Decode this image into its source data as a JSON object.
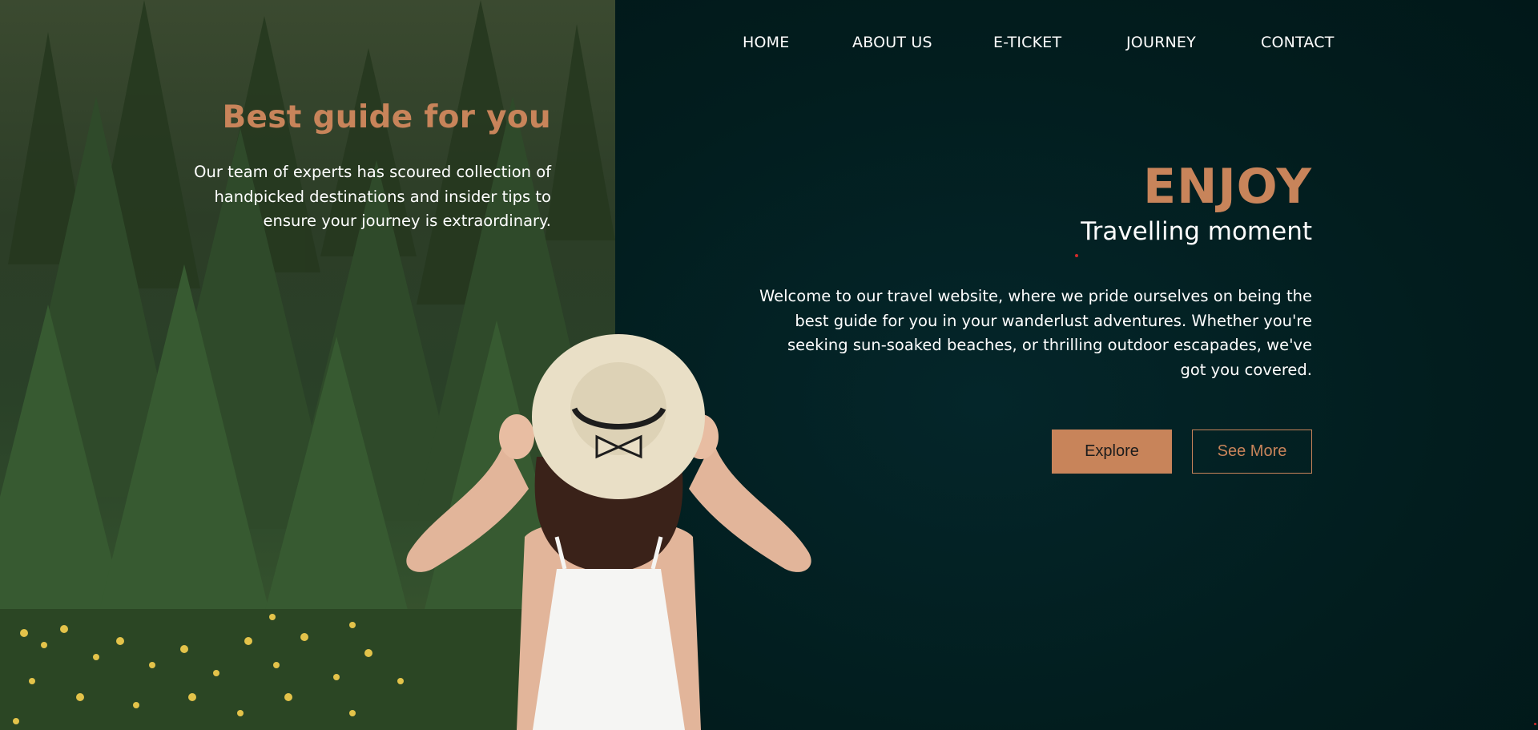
{
  "nav": {
    "items": [
      "HOME",
      "ABOUT US",
      "E-TICKET",
      "JOURNEY",
      "CONTACT"
    ]
  },
  "guide": {
    "title": "Best guide for you",
    "text": "Our team of experts has scoured collection of handpicked destinations and insider tips to ensure your journey is extraordinary."
  },
  "hero": {
    "headline": "ENJOY",
    "subtitle": "Travelling moment",
    "intro": "Welcome to our travel website, where we pride ourselves on being the best guide for you in your wanderlust adventures. Whether you're seeking sun-soaked beaches, or thrilling outdoor escapades, we've got you covered."
  },
  "buttons": {
    "explore": "Explore",
    "see_more": "See More"
  },
  "colors": {
    "accent": "#c8845a",
    "background": "#021d1e",
    "text": "#ffffff"
  }
}
